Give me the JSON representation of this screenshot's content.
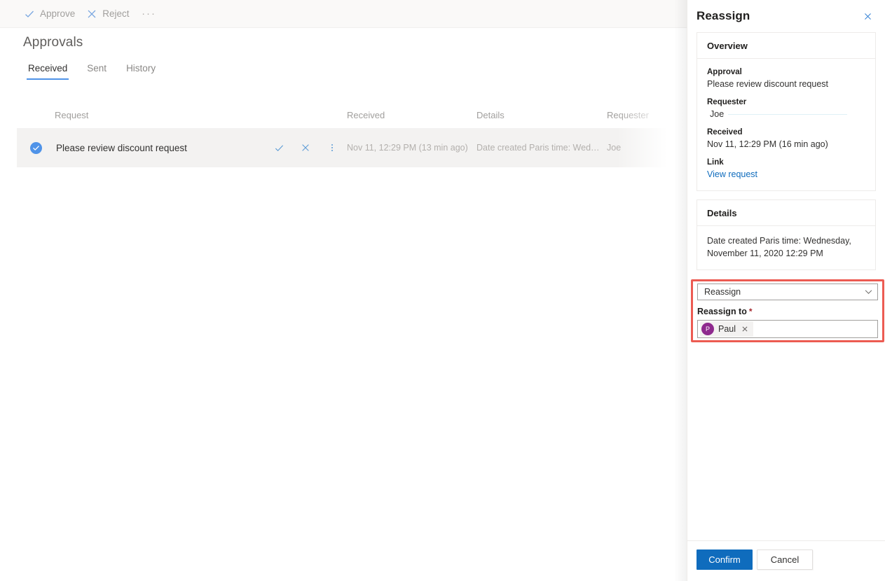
{
  "commandbar": {
    "approve_label": "Approve",
    "reject_label": "Reject",
    "overflow_label": "···"
  },
  "page": {
    "title": "Approvals"
  },
  "tabs": [
    {
      "label": "Received",
      "active": true
    },
    {
      "label": "Sent",
      "active": false
    },
    {
      "label": "History",
      "active": false
    }
  ],
  "table": {
    "headers": {
      "request": "Request",
      "received": "Received",
      "details": "Details",
      "requester": "Requester"
    },
    "rows": [
      {
        "selected": true,
        "request": "Please review discount request",
        "received": "Nov 11, 12:29 PM (13 min ago)",
        "details": "Date created Paris time: Wednesday,...",
        "requester": "Joe"
      }
    ]
  },
  "panel": {
    "title": "Reassign",
    "close_label": "Close",
    "overview": {
      "heading": "Overview",
      "approval_label": "Approval",
      "approval_value": "Please review discount request",
      "requester_label": "Requester",
      "requester_value": "Joe",
      "received_label": "Received",
      "received_value": "Nov 11, 12:29 PM (16 min ago)",
      "link_label": "Link",
      "link_text": "View request"
    },
    "details": {
      "heading": "Details",
      "text": "Date created Paris time: Wednesday, November 11, 2020 12:29 PM"
    },
    "reassign": {
      "action_value": "Reassign",
      "reassign_to_label": "Reassign to",
      "required_marker": "*",
      "person": {
        "initial": "P",
        "name": "Paul",
        "remove_label": "Remove"
      },
      "highlight_color": "#ec5b52"
    },
    "footer": {
      "confirm_label": "Confirm",
      "cancel_label": "Cancel"
    }
  }
}
